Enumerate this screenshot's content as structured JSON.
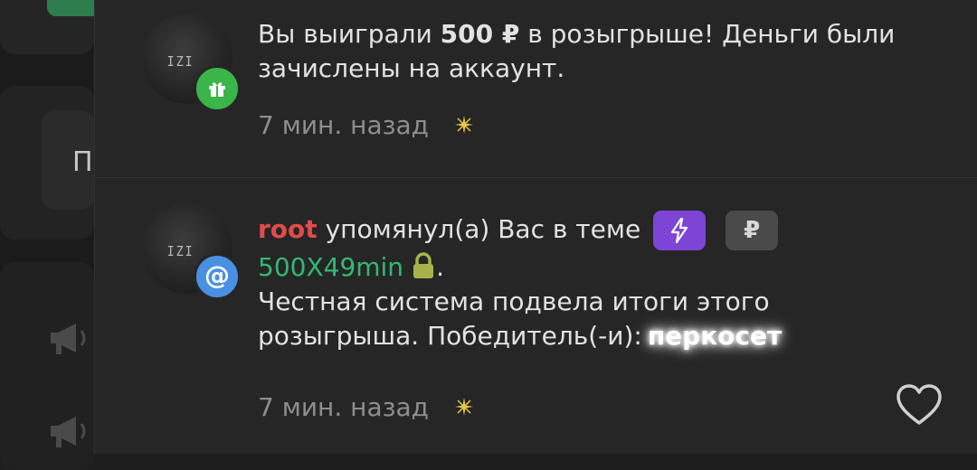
{
  "background": {
    "side_letter": "П",
    "accent_color": "#2e7d4e"
  },
  "notifications": [
    {
      "type": "prize",
      "avatar_tag": "IZI",
      "badge_icon": "gift-icon",
      "badge_color": "#3ab54a",
      "text_before": "Вы выиграли ",
      "amount": "500 ₽",
      "text_after": " в розыгрыше! Деньги были зачислены на аккаунт.",
      "time": "7 мин. назад"
    },
    {
      "type": "mention",
      "avatar_tag": "IZI",
      "badge_icon": "at-icon",
      "badge_symbol": "@",
      "badge_color": "#4a90e2",
      "username": "root",
      "username_color": "#e24b4b",
      "text_mention": " упомянул(а) Вас в теме",
      "prefix_icons": [
        "lightning-icon",
        "ruble-icon"
      ],
      "ruble_symbol": "₽",
      "thread_title": "500X49min",
      "thread_title_color": "#33b873",
      "title_end": ".",
      "body": "Честная система подвела итоги этого розыгрыша. Победитель(-и):",
      "winner": "перкосет",
      "time": "7 мин. назад",
      "like_icon": "heart-icon"
    }
  ]
}
